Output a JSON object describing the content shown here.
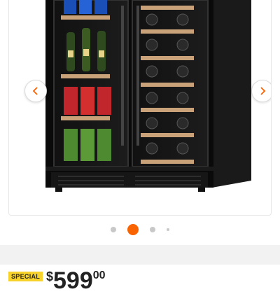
{
  "carousel": {
    "current_index": 2,
    "total": 4,
    "prev_icon": "chevron-left-icon",
    "next_icon": "chevron-right-icon",
    "accent_color": "#f96302"
  },
  "price_block": {
    "badge": "SPECIAL",
    "currency": "$",
    "dollars": "599",
    "cents": "00",
    "badge_color": "#f6d22b"
  }
}
